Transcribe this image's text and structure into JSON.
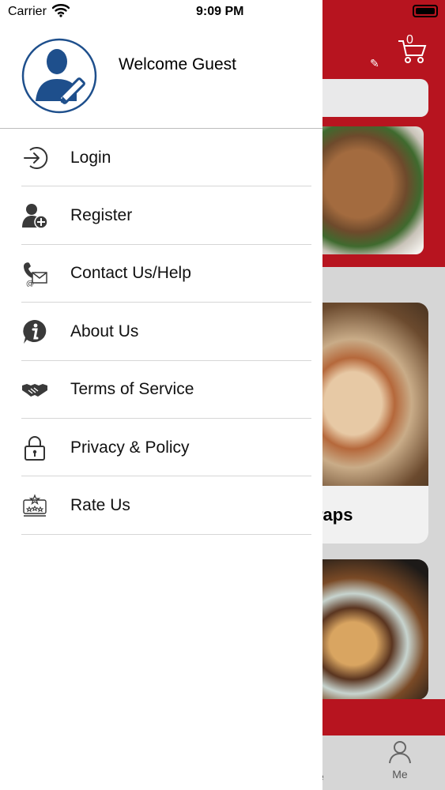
{
  "status_bar": {
    "carrier": "Carrier",
    "time": "9:09 PM"
  },
  "drawer": {
    "welcome_text": "Welcome Guest",
    "menu": [
      {
        "label": "Login",
        "icon": "login-arrow-icon"
      },
      {
        "label": "Register",
        "icon": "add-user-icon"
      },
      {
        "label": "Contact Us/Help",
        "icon": "phone-mail-icon"
      },
      {
        "label": "About Us",
        "icon": "info-bubble-icon"
      },
      {
        "label": "Terms of Service",
        "icon": "handshake-icon"
      },
      {
        "label": "Privacy & Policy",
        "icon": "lock-icon"
      },
      {
        "label": "Rate Us",
        "icon": "rating-stars-icon"
      }
    ]
  },
  "background_app": {
    "cart_count": "0",
    "card_title_fragment": "raps",
    "tab_fragment": "e",
    "tab_me_label": "Me",
    "brand_color": "#b7141f"
  }
}
